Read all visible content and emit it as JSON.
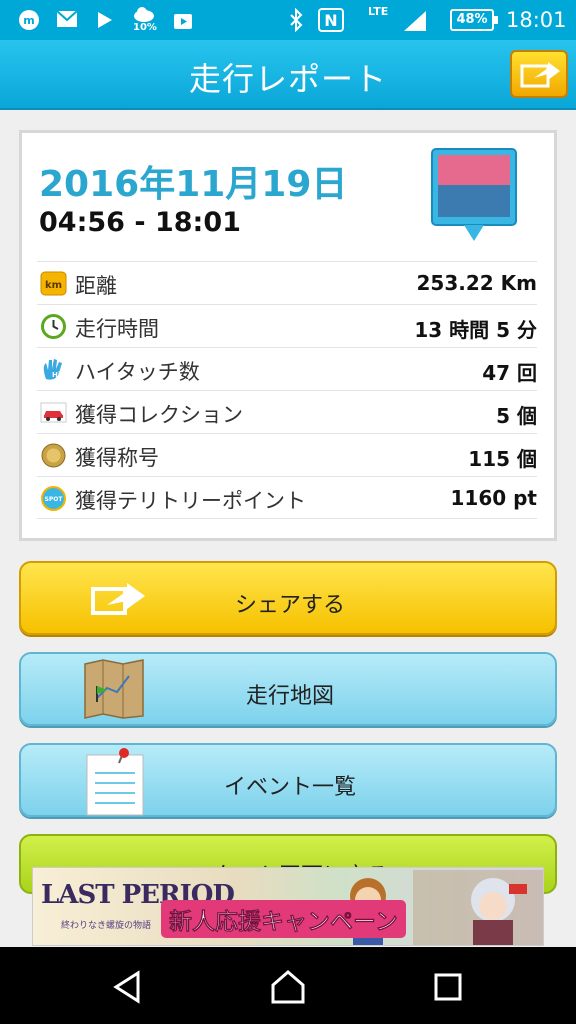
{
  "status_bar": {
    "icons": [
      "messenger-icon",
      "mail-icon",
      "media-icon",
      "weather-icon",
      "store-icon",
      "bluetooth-icon",
      "nfc-icon",
      "signal-icon"
    ],
    "weather_pct": "10%",
    "network": "LTE",
    "battery": "48%",
    "time": "18:01"
  },
  "header": {
    "title": "走行レポート",
    "share_icon": "share-icon"
  },
  "report": {
    "date": "2016年11月19日",
    "time_range": "04:56 - 18:01",
    "rows": [
      {
        "icon": "km-icon",
        "label": "距離",
        "value": "253.22 Km"
      },
      {
        "icon": "clock-icon",
        "label": "走行時間",
        "value": "13 時間 5 分"
      },
      {
        "icon": "hi-touch-icon",
        "label": "ハイタッチ数",
        "value": "47 回"
      },
      {
        "icon": "car-icon",
        "label": "獲得コレクション",
        "value": "5 個"
      },
      {
        "icon": "medal-icon",
        "label": "獲得称号",
        "value": "115 個"
      },
      {
        "icon": "spot-icon",
        "label": "獲得テリトリーポイント",
        "value": "1160 pt"
      }
    ],
    "icon_text": {
      "km": "km",
      "spot": "SPOT",
      "hi": "Hi!"
    }
  },
  "buttons": {
    "share": "シェアする",
    "map": "走行地図",
    "events": "イベント一覧",
    "start": "スタート画面に戻る"
  },
  "ad": {
    "logo": "LAST PERIOD",
    "sublogo": "終わりなき螺旋の物語",
    "campaign": "新人応援キャンペーン"
  },
  "colors": {
    "header": "#0aa6d8",
    "date": "#2aa6cf",
    "share_button": "#f6c100",
    "nav_button": "#7dd2ec",
    "start_button": "#a9d31b"
  }
}
